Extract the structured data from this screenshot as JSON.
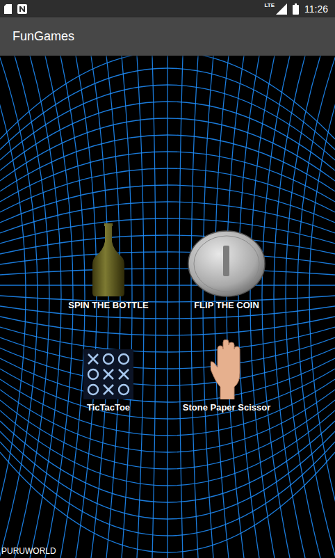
{
  "status_bar": {
    "network": "LTE",
    "time": "11:26"
  },
  "app_bar": {
    "title": "FunGames"
  },
  "games": [
    {
      "label": "SPIN THE BOTTLE",
      "kind": "bottle"
    },
    {
      "label": "FLIP THE COIN",
      "kind": "coin"
    },
    {
      "label": "TicTacToe",
      "kind": "tictactoe"
    },
    {
      "label": "Stone Paper Scissor",
      "kind": "hand"
    }
  ],
  "footer": "PURUWORLD"
}
